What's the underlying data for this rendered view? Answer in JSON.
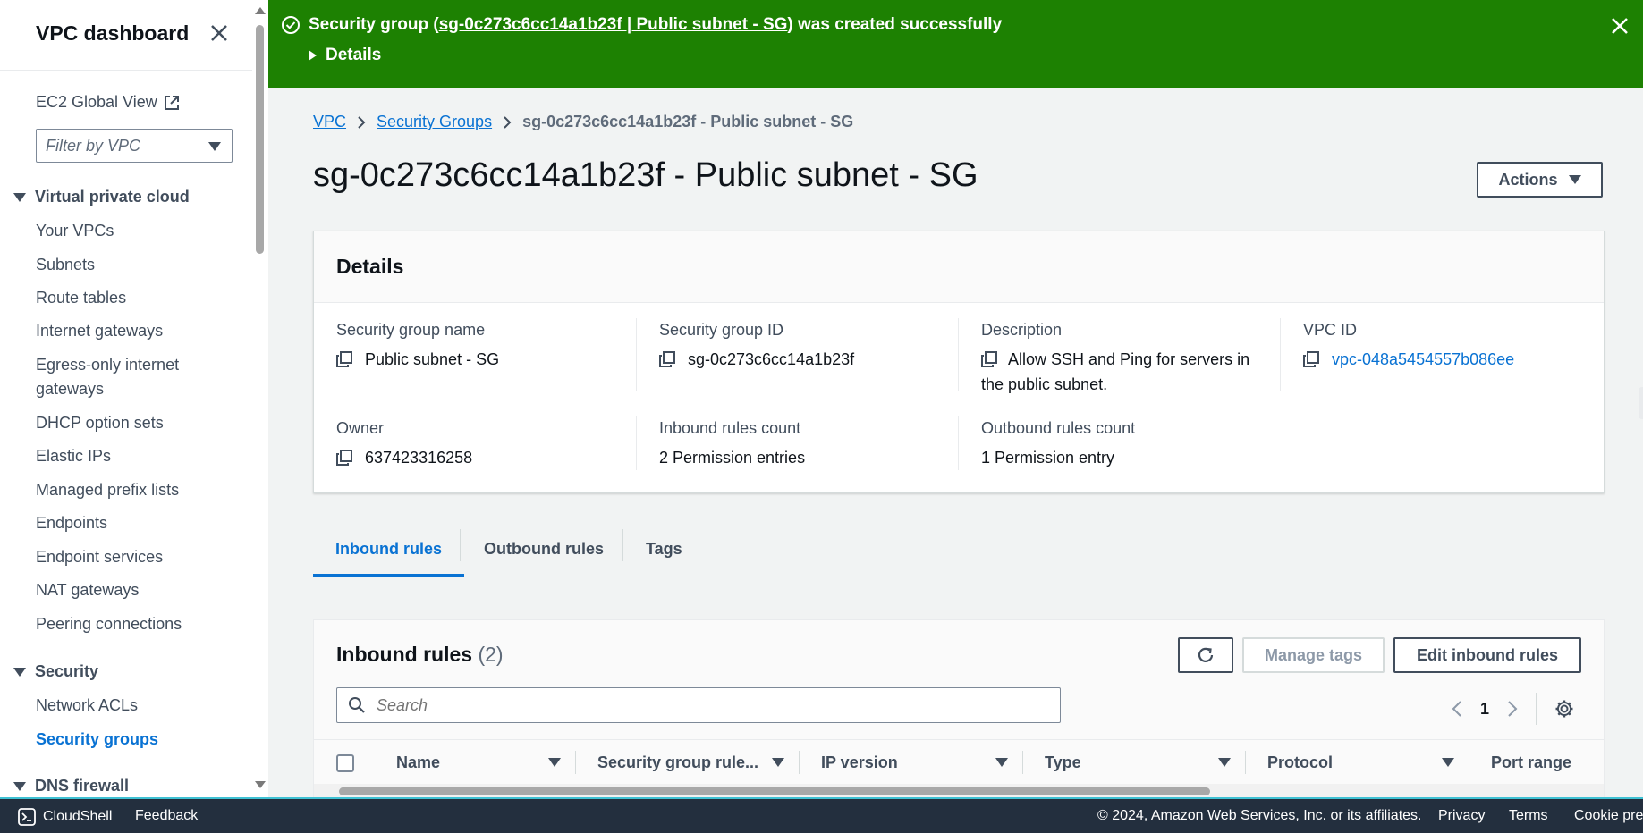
{
  "sidebar": {
    "title": "VPC dashboard",
    "global_view": "EC2 Global View",
    "filter_placeholder": "Filter by VPC",
    "sections": {
      "vpc": "Virtual private cloud",
      "security": "Security",
      "dns": "DNS firewall"
    },
    "vpc_items": [
      "Your VPCs",
      "Subnets",
      "Route tables",
      "Internet gateways",
      "Egress-only internet",
      "gateways",
      "DHCP option sets",
      "Elastic IPs",
      "Managed prefix lists",
      "Endpoints",
      "Endpoint services",
      "NAT gateways",
      "Peering connections"
    ],
    "security_items": [
      "Network ACLs",
      "Security groups"
    ]
  },
  "flash": {
    "prefix": "Security group (",
    "link": "sg-0c273c6cc14a1b23f | Public subnet - SG",
    "suffix": ") was created successfully",
    "details": "Details"
  },
  "breadcrumb": {
    "vpc": "VPC",
    "security_groups": "Security Groups",
    "current": "sg-0c273c6cc14a1b23f - Public subnet - SG"
  },
  "page": {
    "title": "sg-0c273c6cc14a1b23f - Public subnet - SG",
    "actions": "Actions"
  },
  "details": {
    "heading": "Details",
    "name_label": "Security group name",
    "name_value": "Public subnet - SG",
    "id_label": "Security group ID",
    "id_value": "sg-0c273c6cc14a1b23f",
    "desc_label": "Description",
    "desc_value": "Allow SSH and Ping for servers in the public subnet.",
    "vpc_label": "VPC ID",
    "vpc_value": "vpc-048a5454557b086ee",
    "owner_label": "Owner",
    "owner_value": "637423316258",
    "inbound_label": "Inbound rules count",
    "inbound_value": "2 Permission entries",
    "outbound_label": "Outbound rules count",
    "outbound_value": "1 Permission entry"
  },
  "tabs": [
    "Inbound rules",
    "Outbound rules",
    "Tags"
  ],
  "rules": {
    "title": "Inbound rules",
    "count": "(2)",
    "manage_tags": "Manage tags",
    "edit": "Edit inbound rules",
    "search_placeholder": "Search",
    "page": "1",
    "columns": [
      "Name",
      "Security group rule...",
      "IP version",
      "Type",
      "Protocol",
      "Port range"
    ]
  },
  "footer": {
    "cloudshell": "CloudShell",
    "feedback": "Feedback",
    "copyright": "© 2024, Amazon Web Services, Inc. or its affiliates.",
    "privacy": "Privacy",
    "terms": "Terms",
    "cookie": "Cookie pref"
  },
  "colors": {
    "success": "#1d8102",
    "link": "#0972d3",
    "footer_bg": "#232f3e"
  },
  "icons": [
    "close-icon",
    "external-link-icon",
    "success-check-icon",
    "copy-icon",
    "refresh-icon",
    "search-icon",
    "settings-gear-icon",
    "chevron-left-icon",
    "chevron-right-icon",
    "cloudshell-icon"
  ]
}
